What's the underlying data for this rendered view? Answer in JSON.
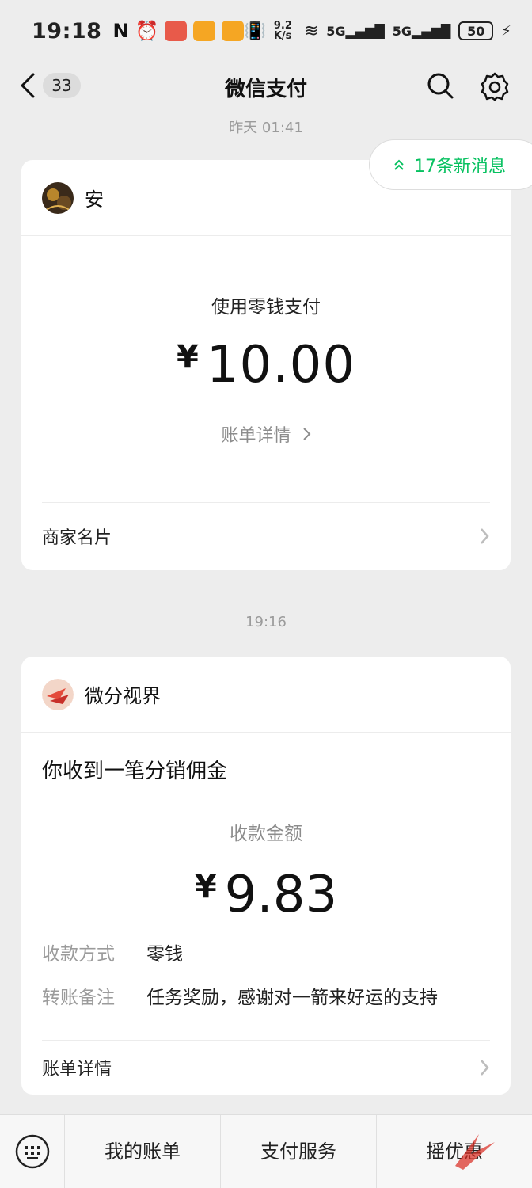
{
  "status_bar": {
    "time": "19:18",
    "net_speed": "9.2 K/s",
    "battery": "50"
  },
  "header": {
    "unread_count": "33",
    "title": "微信支付"
  },
  "new_messages": "17条新消息",
  "card1": {
    "timestamp": "昨天 01:41",
    "name": "安",
    "label": "使用零钱支付",
    "currency": "¥",
    "amount": "10.00",
    "bill_link": "账单详情",
    "merchant_card": "商家名片"
  },
  "card2": {
    "timestamp": "19:16",
    "name": "微分视界",
    "title": "你收到一笔分销佣金",
    "label": "收款金额",
    "currency": "¥",
    "amount": "9.83",
    "method_key": "收款方式",
    "method_value": "零钱",
    "note_key": "转账备注",
    "note_value": "任务奖励，感谢对一箭来好运的支持",
    "bill_link": "账单详情"
  },
  "bottom_menu": {
    "items": [
      "我的账单",
      "支付服务",
      "摇优惠"
    ]
  },
  "colors": {
    "accent": "#07c160",
    "background": "#ededed"
  }
}
